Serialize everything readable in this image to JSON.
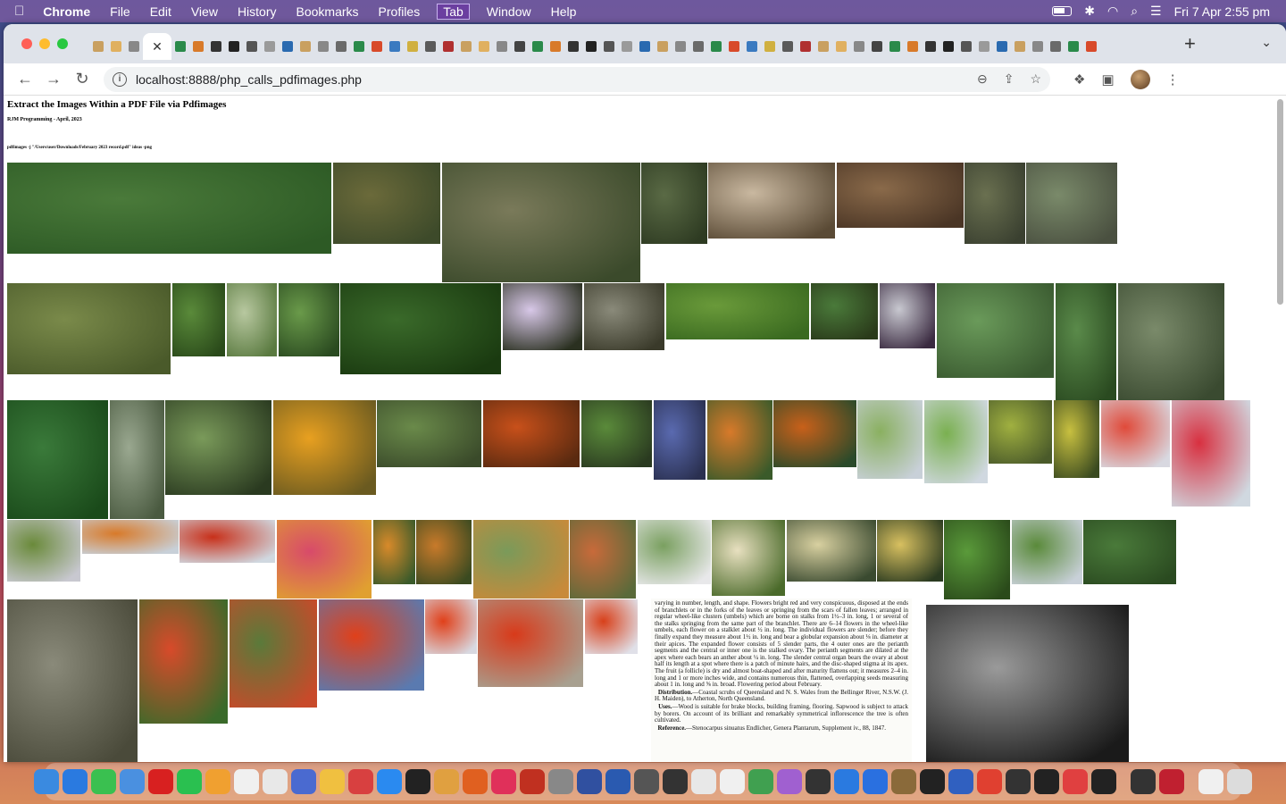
{
  "menubar": {
    "app_name": "Chrome",
    "items": [
      "File",
      "Edit",
      "View",
      "History",
      "Bookmarks",
      "Profiles",
      "Tab",
      "Window",
      "Help"
    ],
    "selected_item": "Tab",
    "clock": "Fri 7 Apr  2:55 pm"
  },
  "browser": {
    "url": "localhost:8888/php_calls_pdfimages.php",
    "active_tab_close": "✕",
    "new_tab": "+",
    "tab_menu": "⌄"
  },
  "page": {
    "title": "Extract the Images Within a PDF File via Pdfimages",
    "byline": "RJM Programming - April, 2023",
    "command": "pdfimages -j \"/Users/user/Downloads/February 2023 record.pdf\" ideas -png"
  },
  "pdf_text": {
    "lines": [
      "varying in number, length, and shape. Flowers bright red and very conspicuous, disposed at the ends of branchlets or in the forks of the leaves or springing from the scars of fallen leaves; arranged in regular wheel-like clusters (umbels) which are borne on stalks from 1½–3 in. long, 1 or several of the stalks springing from the same part of the branchlet. There are 6–14 flowers in the wheel-like umbels, each flower on a stalklet about ½ in. long. The individual flowers are slender; before they finally expand they measure about 1½ in. long and bear a globular expansion about ⅛ in. diameter at their apices. The expanded flower consists of 5 slender parts, the 4 outer ones are the perianth segments and the central or inner one is the stalked ovary. The perianth segments are dilated at the apex where each bears an anther about ¼ in. long. The slender central organ bears the ovary at about half its length at a spot where there is a patch of minute hairs, and the disc-shaped stigma at its apex. The fruit (a follicle) is dry and almost boat-shaped and after maturity flattens out; it measures 2–4 in. long and 1 or more inches wide, and contains numerous thin, flattened, overlapping seeds measuring about 1 in. long and ⅝ in. broad. Flowering period about February."
    ],
    "distribution_label": "Distribution.",
    "distribution": "—Coastal scrubs of Queensland and N. S. Wales from the Bellinger River, N.S.W. (J. H. Maiden), to Atherton, North Queensland.",
    "uses_label": "Uses.",
    "uses": "—Wood is suitable for brake blocks, building framing, flooring. Sapwood is subject to attack by borers. On account of its brilliant and remarkably symmetrical inflorescence the tree is often cultivated.",
    "reference_label": "Reference.",
    "reference": "—Stenocarpus sinuatus Endlicher, Genera Plantarum, Supplement iv., 88, 1847."
  },
  "images": [
    {
      "name": "hillside-landscape",
      "c1": "#4a7a3a",
      "c2": "#2d5a25"
    },
    {
      "name": "forest-path-1",
      "c1": "#6b6a3a",
      "c2": "#3d4a2a"
    },
    {
      "name": "forest-trail",
      "c1": "#7a7a5a",
      "c2": "#3b4a2b"
    },
    {
      "name": "forest-undergrowth",
      "c1": "#5a6a45",
      "c2": "#2e3b22"
    },
    {
      "name": "mushroom-cluster",
      "c1": "#c9b8a0",
      "c2": "#5a4a35"
    },
    {
      "name": "leaf-litter",
      "c1": "#8a6a4a",
      "c2": "#4a3525"
    },
    {
      "name": "forest-track",
      "c1": "#6a7050",
      "c2": "#3a4030"
    },
    {
      "name": "forest-clearing",
      "c1": "#7a8a6a",
      "c2": "#4a5040"
    },
    {
      "name": "grassy-slope",
      "c1": "#7a8a4a",
      "c2": "#4a5a2a"
    },
    {
      "name": "lily-leaves",
      "c1": "#5a8a3a",
      "c2": "#2a4a1a"
    },
    {
      "name": "pale-sheath",
      "c1": "#b8c8a0",
      "c2": "#5a7a40"
    },
    {
      "name": "spiky-plant",
      "c1": "#6a9a4a",
      "c2": "#2a4a20"
    },
    {
      "name": "palm-fronds",
      "c1": "#3a6a2a",
      "c2": "#1a3a10"
    },
    {
      "name": "pale-orchid",
      "c1": "#d8c8e8",
      "c2": "#2a3020"
    },
    {
      "name": "orchid-bark",
      "c1": "#8a8a7a",
      "c2": "#3a3a2a"
    },
    {
      "name": "green-berries",
      "c1": "#6a9a3a",
      "c2": "#3a6a20"
    },
    {
      "name": "berries-branch",
      "c1": "#4a7a3a",
      "c2": "#2a3a1a"
    },
    {
      "name": "dark-berries",
      "c1": "#c8c8d0",
      "c2": "#3a2a40"
    },
    {
      "name": "branch-leaves",
      "c1": "#6a9a5a",
      "c2": "#3a5a30"
    },
    {
      "name": "vine-trunk-1",
      "c1": "#5a8a4a",
      "c2": "#2a4a20"
    },
    {
      "name": "vine-trunk-2",
      "c1": "#7a8a6a",
      "c2": "#3a4a30"
    },
    {
      "name": "ivy-trunk",
      "c1": "#3a7a3a",
      "c2": "#1a4a1a"
    },
    {
      "name": "climbing-vine",
      "c1": "#9aa890",
      "c2": "#4a5a40"
    },
    {
      "name": "small-fruit-branch",
      "c1": "#7a9a5a",
      "c2": "#2a3a20"
    },
    {
      "name": "yellow-flowers",
      "c1": "#e8a020",
      "c2": "#6a5a20"
    },
    {
      "name": "fruit-leaves",
      "c1": "#6a8a4a",
      "c2": "#3a4a2a"
    },
    {
      "name": "red-seeds-ground",
      "c1": "#c8501a",
      "c2": "#5a2a10"
    },
    {
      "name": "green-stem",
      "c1": "#5a8a3a",
      "c2": "#2a3a20"
    },
    {
      "name": "blue-flowers",
      "c1": "#5a6ab0",
      "c2": "#2a3050"
    },
    {
      "name": "orange-berries-1",
      "c1": "#d87a2a",
      "c2": "#3a5a2a"
    },
    {
      "name": "orange-berries-2",
      "c1": "#c8601a",
      "c2": "#2a4a2a"
    },
    {
      "name": "green-fruit-grid",
      "c1": "#8ab060",
      "c2": "#c8d0d8"
    },
    {
      "name": "leaf-sprig-grid",
      "c1": "#7ab050",
      "c2": "#d0d8e0"
    },
    {
      "name": "green-pods",
      "c1": "#a0b040",
      "c2": "#4a5a2a"
    },
    {
      "name": "yellow-fruit-branch",
      "c1": "#c8c040",
      "c2": "#3a4a20"
    },
    {
      "name": "red-apples",
      "c1": "#e04a3a",
      "c2": "#d8d8e0"
    },
    {
      "name": "red-cherries-grid",
      "c1": "#d83040",
      "c2": "#d0d8e0"
    },
    {
      "name": "green-limes",
      "c1": "#6a8a3a",
      "c2": "#c8c8d0"
    },
    {
      "name": "orange-pod",
      "c1": "#d87a2a",
      "c2": "#c8d0d8"
    },
    {
      "name": "split-pod-seeds",
      "c1": "#c8301a",
      "c2": "#d0d8e0"
    },
    {
      "name": "red-berries-pod",
      "c1": "#d84a6a",
      "c2": "#e0a030"
    },
    {
      "name": "orange-flower-buds",
      "c1": "#d88a2a",
      "c2": "#3a5a2a"
    },
    {
      "name": "curled-pods",
      "c1": "#c87a2a",
      "c2": "#3a4a20"
    },
    {
      "name": "flower-leaves",
      "c1": "#7a9a5a",
      "c2": "#c88a3a"
    },
    {
      "name": "flower-cluster",
      "c1": "#c86a3a",
      "c2": "#5a6a3a"
    },
    {
      "name": "leafy-sprig",
      "c1": "#7aa060",
      "c2": "#e8e8ea"
    },
    {
      "name": "pale-blossom",
      "c1": "#e8e0c0",
      "c2": "#4a6a2a"
    },
    {
      "name": "cream-flowers",
      "c1": "#d8d0a0",
      "c2": "#3a4a30"
    },
    {
      "name": "yellow-cluster",
      "c1": "#d8c060",
      "c2": "#2a3a20"
    },
    {
      "name": "long-leaves",
      "c1": "#5a9a3a",
      "c2": "#2a4a1a"
    },
    {
      "name": "hanging-pods",
      "c1": "#5a8a3a",
      "c2": "#c8d0d8"
    },
    {
      "name": "tree-canopy",
      "c1": "#4a7a3a",
      "c2": "#2a4a20"
    },
    {
      "name": "tree-bark",
      "c1": "#8a8a7a",
      "c2": "#4a4a3a"
    },
    {
      "name": "red-flower-tree",
      "c1": "#d84a2a",
      "c2": "#3a6a2a"
    },
    {
      "name": "flowering-tree",
      "c1": "#5a7a3a",
      "c2": "#c84a2a"
    },
    {
      "name": "red-flower-sky",
      "c1": "#e0401a",
      "c2": "#5a7ab0"
    },
    {
      "name": "red-flower-grid-1",
      "c1": "#e0401a",
      "c2": "#d8d8e0"
    },
    {
      "name": "firewheel-flower",
      "c1": "#d83a1a",
      "c2": "#a8a090"
    },
    {
      "name": "red-flower-grid-2",
      "c1": "#d8401a",
      "c2": "#e0e0e8"
    },
    {
      "name": "bw-tree-photo",
      "c1": "#9a9a9a",
      "c2": "#1a1a1a"
    }
  ]
}
